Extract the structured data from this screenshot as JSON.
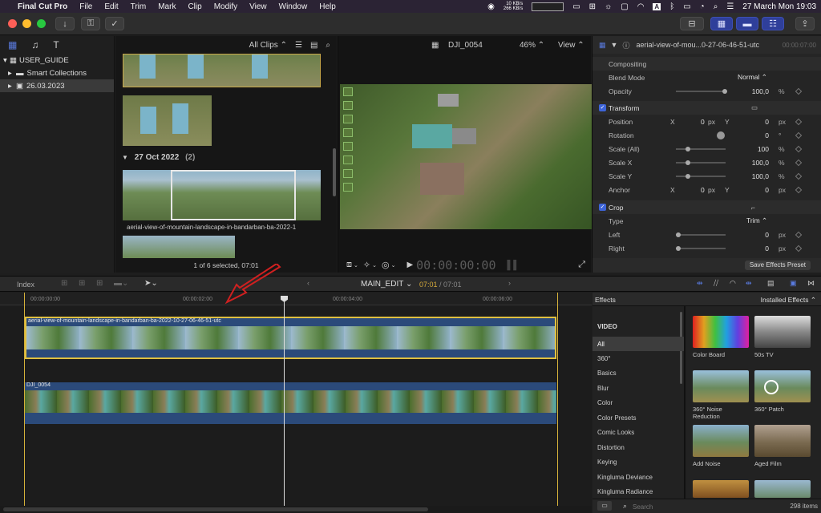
{
  "menubar": {
    "app_name": "Final Cut Pro",
    "items": [
      "File",
      "Edit",
      "Trim",
      "Mark",
      "Clip",
      "Modify",
      "View",
      "Window",
      "Help"
    ],
    "net_up": "10 KB/s",
    "net_down": "266 KB/s",
    "datetime": "27 March Mon 19:03"
  },
  "library": {
    "items": [
      {
        "label": "USER_GUIDE",
        "indent": 0,
        "arrow": "▾"
      },
      {
        "label": "Smart Collections",
        "indent": 1,
        "arrow": "▸"
      },
      {
        "label": "26.03.2023",
        "indent": 1,
        "arrow": "▸"
      }
    ]
  },
  "browser": {
    "filter": "All Clips",
    "date_group": "27 Oct 2022",
    "date_count": "(2)",
    "clip_name": "aerial-view-of-mountain-landscape-in-bandarban-ba-2022-1",
    "status": "1 of 6 selected, 07:01"
  },
  "viewer": {
    "clip": "DJI_0054",
    "zoom": "46%",
    "view_label": "View",
    "timecode": "00:00:00:00"
  },
  "inspector": {
    "title": "aerial-view-of-mou...0-27-06-46-51-utc",
    "time": "00:00:07:00",
    "compositing": "Compositing",
    "blend_mode_label": "Blend Mode",
    "blend_mode": "Normal",
    "opacity_label": "Opacity",
    "opacity": "100,0",
    "transform": "Transform",
    "position_label": "Position",
    "pos_x": "0",
    "pos_y": "0",
    "rotation_label": "Rotation",
    "rotation": "0",
    "scale_all_label": "Scale (All)",
    "scale_all": "100",
    "scale_x_label": "Scale X",
    "scale_x": "100,0",
    "scale_y_label": "Scale Y",
    "scale_y": "100,0",
    "anchor_label": "Anchor",
    "anchor_x": "0",
    "anchor_y": "0",
    "crop": "Crop",
    "type_label": "Type",
    "type": "Trim",
    "left_label": "Left",
    "left": "0",
    "right_label": "Right",
    "right": "0",
    "save_preset": "Save Effects Preset",
    "unit_px": "px",
    "unit_pct": "%",
    "unit_deg": "°",
    "x": "X",
    "y": "Y"
  },
  "timeline": {
    "index_label": "Index",
    "project": "MAIN_EDIT",
    "duration_current": "07:01",
    "duration_total": "/ 07:01",
    "ticks": [
      "00:00:00:00",
      "00:00:02:00",
      "00:00:04:00",
      "00:00:06:00"
    ],
    "clip1_name": "aerial-view-of-mountain-landscape-in-bandarban-ba-2022-10-27-06-46-51-utc",
    "clip2_name": "DJI_0054"
  },
  "effects": {
    "header": "Effects",
    "installed": "Installed Effects",
    "section": "VIDEO",
    "categories": [
      "All",
      "360°",
      "Basics",
      "Blur",
      "Color",
      "Color Presets",
      "Comic Looks",
      "Distortion",
      "Keying",
      "Kingluma Deviance",
      "Kingluma Radiance"
    ],
    "items": [
      "Color Board",
      "50s TV",
      "360° Noise Reduction",
      "360° Patch",
      "Add Noise",
      "Aged Film"
    ],
    "search_placeholder": "Search",
    "count": "298 items"
  }
}
